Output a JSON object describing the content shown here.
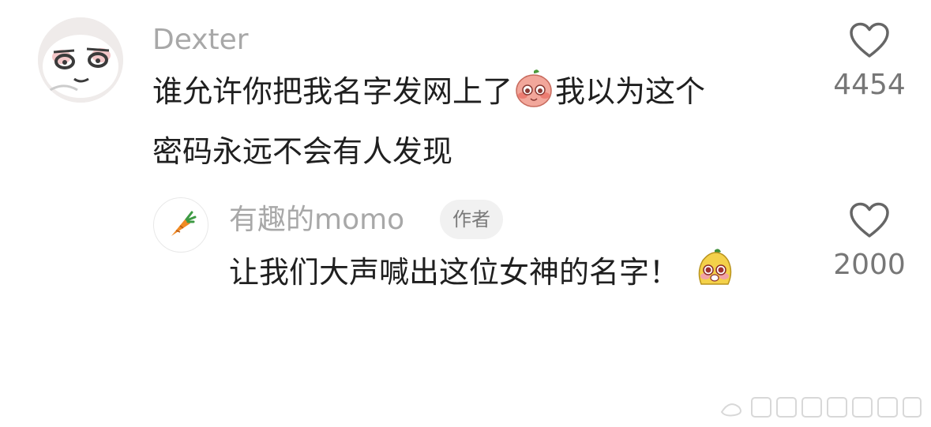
{
  "comments": [
    {
      "username": "Dexter",
      "line1_before_emoji": "谁允许你把我名字发网上了",
      "line1_after_emoji": "我以为这个",
      "line2": "密码永远不会有人发现",
      "emoji_icon": "pink-blushing-face-emoji",
      "like_count": "4454"
    },
    {
      "username": "有趣的momo",
      "badge": "作者",
      "text": "让我们大声喊出这位女神的名字！",
      "emoji_icon": "yellow-blushing-face-emoji",
      "avatar_icon": "carrot-icon",
      "like_count": "2000"
    }
  ],
  "colors": {
    "username": "#a8a8a8",
    "text": "#1f1f1f",
    "count": "#777777",
    "badge_bg": "#f1f1f1"
  }
}
